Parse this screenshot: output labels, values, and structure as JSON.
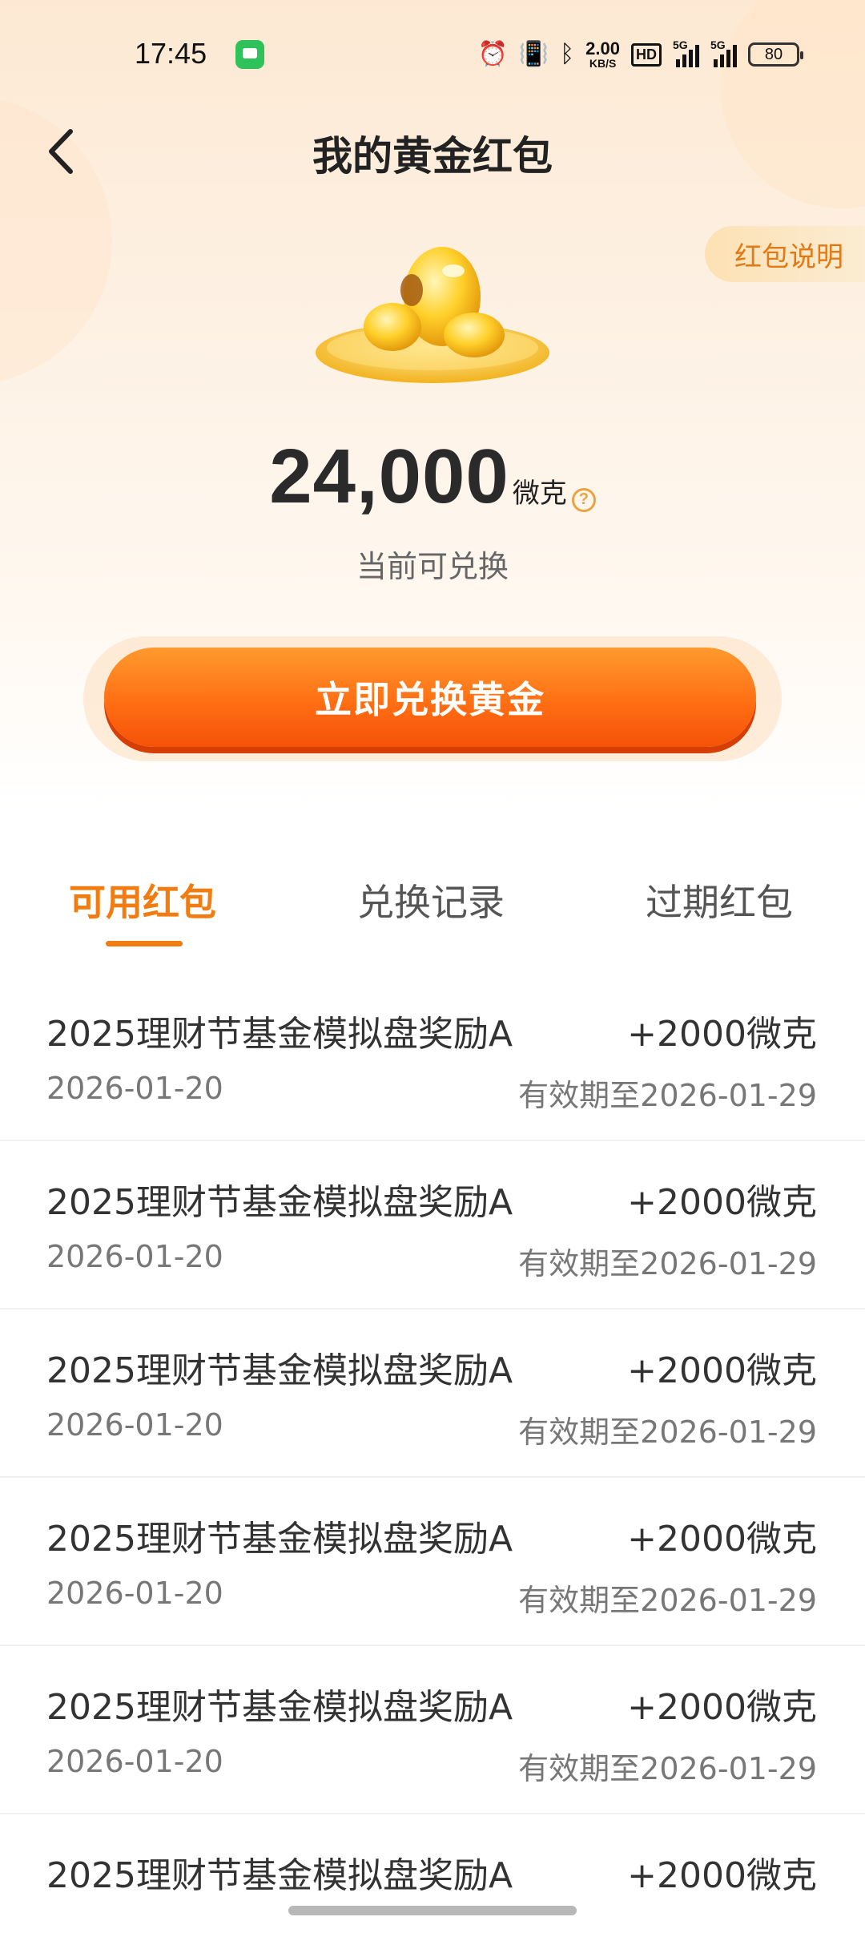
{
  "status_bar": {
    "time": "17:45",
    "net_speed_value": "2.00",
    "net_speed_unit": "KB/S",
    "hd_label": "HD",
    "signal_1_label": "5G",
    "signal_2_label": "5G",
    "battery": "80"
  },
  "header": {
    "title": "我的黄金红包",
    "explain_label": "红包说明"
  },
  "balance": {
    "amount": "24,000",
    "unit": "微克",
    "help_glyph": "?",
    "subtitle": "当前可兑换"
  },
  "cta": {
    "label": "立即兑换黄金"
  },
  "tabs": [
    {
      "label": "可用红包",
      "active": true
    },
    {
      "label": "兑换记录",
      "active": false
    },
    {
      "label": "过期红包",
      "active": false
    }
  ],
  "items": [
    {
      "title": "2025理财节基金模拟盘奖励A",
      "amount": "+2000微克",
      "date": "2026-01-20",
      "expiry": "有效期至2026-01-29"
    },
    {
      "title": "2025理财节基金模拟盘奖励A",
      "amount": "+2000微克",
      "date": "2026-01-20",
      "expiry": "有效期至2026-01-29"
    },
    {
      "title": "2025理财节基金模拟盘奖励A",
      "amount": "+2000微克",
      "date": "2026-01-20",
      "expiry": "有效期至2026-01-29"
    },
    {
      "title": "2025理财节基金模拟盘奖励A",
      "amount": "+2000微克",
      "date": "2026-01-20",
      "expiry": "有效期至2026-01-29"
    },
    {
      "title": "2025理财节基金模拟盘奖励A",
      "amount": "+2000微克",
      "date": "2026-01-20",
      "expiry": "有效期至2026-01-29"
    },
    {
      "title": "2025理财节基金模拟盘奖励A",
      "amount": "+2000微克",
      "date": "",
      "expiry": ""
    }
  ],
  "colors": {
    "accent": "#f07c12",
    "cta_start": "#ff9a2e",
    "cta_end": "#f45208",
    "explain_text": "#e07a16"
  },
  "icons": {
    "back": "back-arrow-icon",
    "help": "question-circle-icon",
    "gold": "gold-nugget-icon"
  }
}
